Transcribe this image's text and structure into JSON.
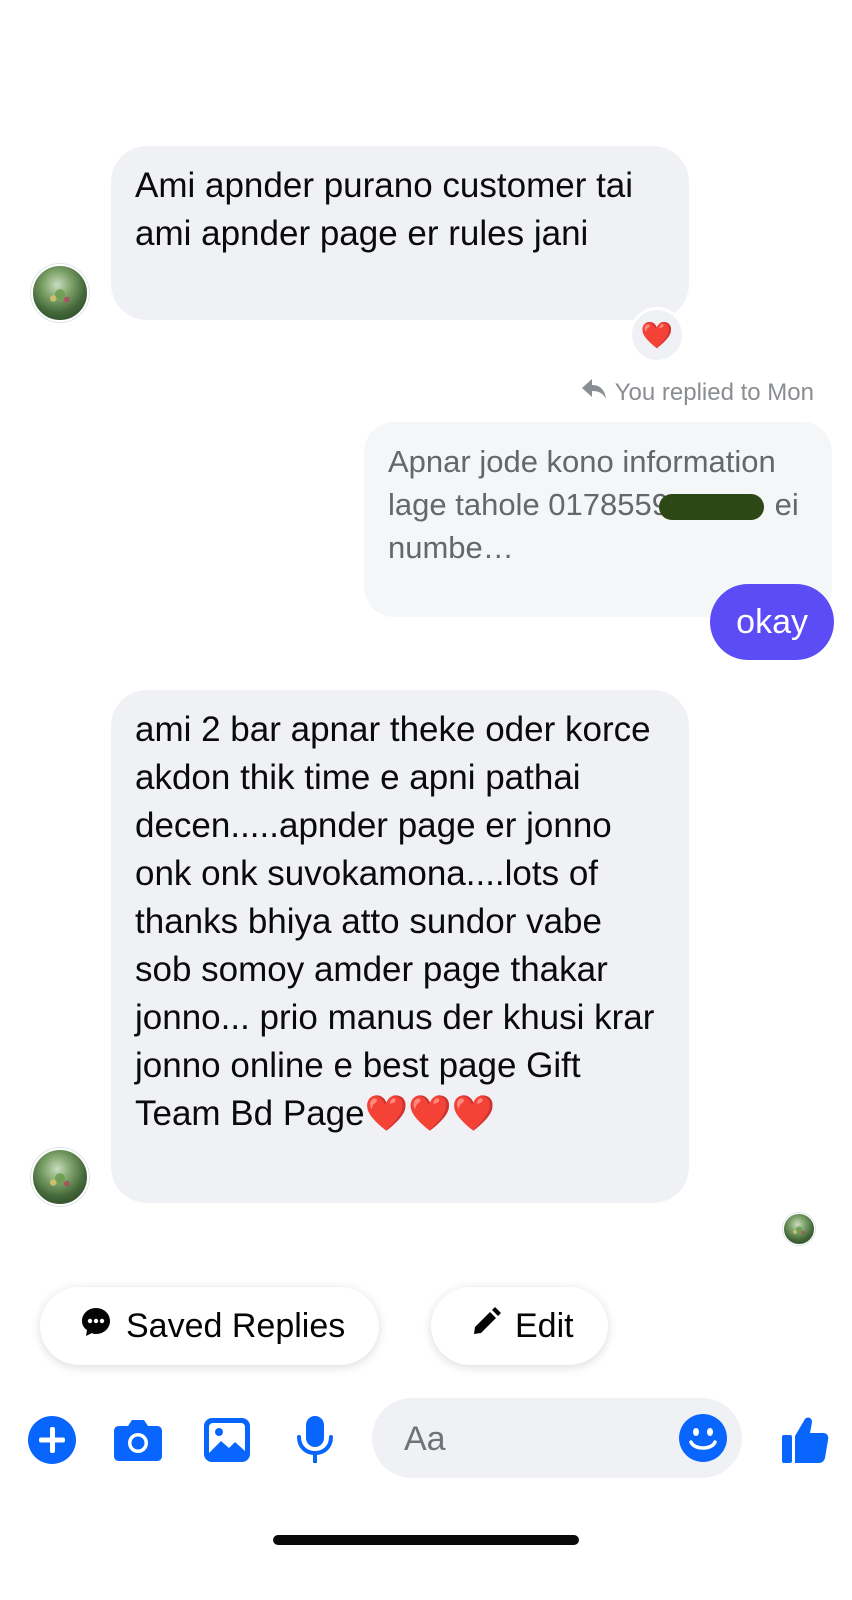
{
  "conversation": {
    "message1": {
      "text": "Ami apnder purano customer tai ami apnder page er rules jani",
      "reaction": "❤️"
    },
    "reply": {
      "label": "You replied to Mon",
      "quoted_text_start": "Apnar jode kono information lage tahole 0178559",
      "quoted_text_end": " ei numbe…",
      "message": "okay"
    },
    "message2": {
      "text": "ami 2 bar apnar theke oder korce akdon thik time e apni pathai decen.....apnder page er jonno onk onk suvokamona....lots of thanks bhiya atto sundor vabe sob somoy amder page thakar jonno... prio manus der khusi krar jonno online e best page Gift Team Bd Page❤️❤️❤️"
    }
  },
  "quick_actions": {
    "saved_replies": "Saved Replies",
    "edit": "Edit"
  },
  "composer": {
    "placeholder": "Aa"
  },
  "colors": {
    "accent": "#0866ff",
    "outgoing_bubble": "#5b4cf5",
    "incoming_bubble": "#f0f1f5"
  },
  "icons": [
    "plus-icon",
    "camera-icon",
    "gallery-icon",
    "microphone-icon",
    "emoji-icon",
    "like-icon",
    "reply-arrow-icon",
    "chat-bubble-icon",
    "pencil-icon"
  ]
}
